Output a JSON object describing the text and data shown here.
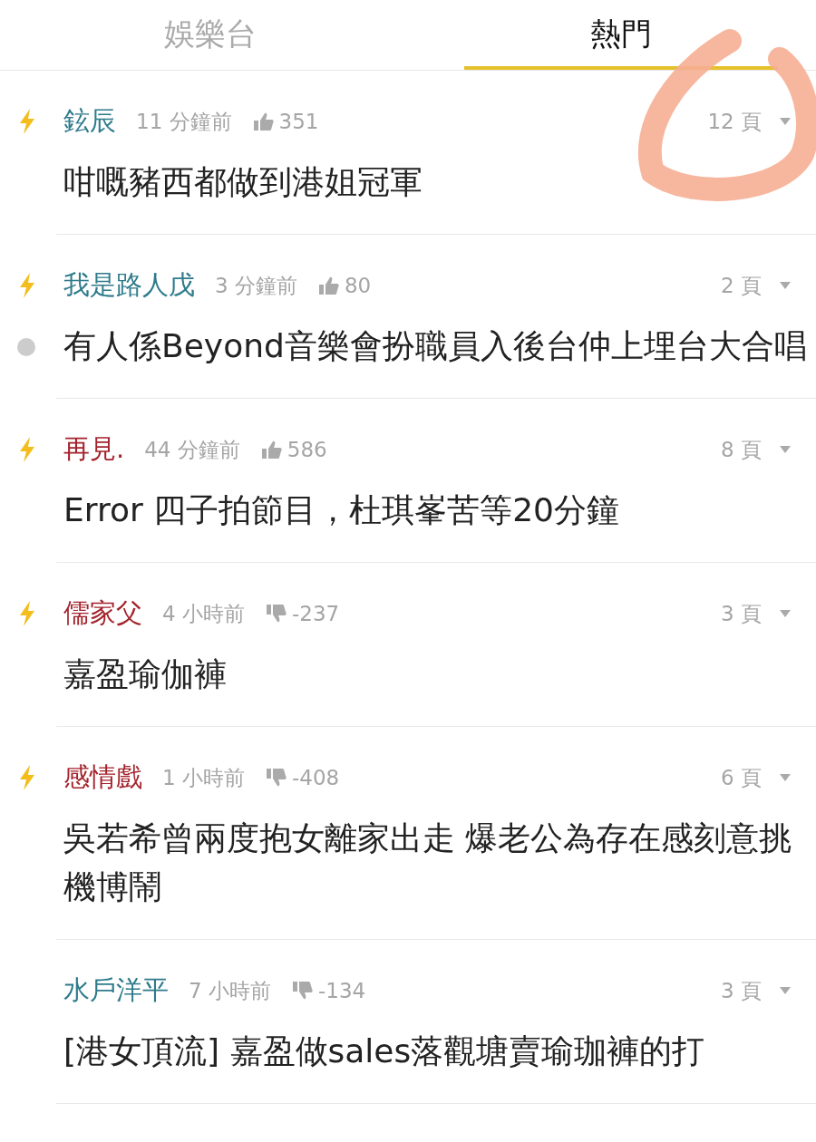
{
  "tabs": [
    {
      "label": "娛樂台",
      "selected": false
    },
    {
      "label": "熱門",
      "selected": true
    }
  ],
  "threads": [
    {
      "author": "鉉辰",
      "color": "#2e7b8c",
      "hot": true,
      "unread": false,
      "time": "11 分鐘前",
      "vote": {
        "kind": "like",
        "score": "351"
      },
      "pages": "12 頁",
      "title": "咁嘅豬西都做到港姐冠軍"
    },
    {
      "author": "我是路人戊",
      "color": "#2e7b8c",
      "hot": true,
      "unread": true,
      "time": "3 分鐘前",
      "vote": {
        "kind": "like",
        "score": "80"
      },
      "pages": "2 頁",
      "title": "有人係Beyond音樂會扮職員入後台仲上埋台大合唱"
    },
    {
      "author": "再見.",
      "color": "#a3232c",
      "hot": true,
      "unread": false,
      "time": "44 分鐘前",
      "vote": {
        "kind": "like",
        "score": "586"
      },
      "pages": "8 頁",
      "title": "Error 四子拍節目，杜琪峯苦等20分鐘"
    },
    {
      "author": "儒家父",
      "color": "#a3232c",
      "hot": true,
      "unread": false,
      "time": "4 小時前",
      "vote": {
        "kind": "dislike",
        "score": "-237"
      },
      "pages": "3 頁",
      "title": "嘉盈瑜伽褲"
    },
    {
      "author": "感情戲",
      "color": "#a3232c",
      "hot": true,
      "unread": false,
      "time": "1 小時前",
      "vote": {
        "kind": "dislike",
        "score": "-408"
      },
      "pages": "6 頁",
      "title": "吳若希曾兩度抱女離家出走 爆老公為存在感刻意挑機博鬧"
    },
    {
      "author": "水戶洋平",
      "color": "#2e7b8c",
      "hot": false,
      "unread": false,
      "time": "7 小時前",
      "vote": {
        "kind": "dislike",
        "score": "-134"
      },
      "pages": "3 頁",
      "title": "[港女頂流] 嘉盈做sales落觀塘賣瑜珈褲的打"
    }
  ]
}
